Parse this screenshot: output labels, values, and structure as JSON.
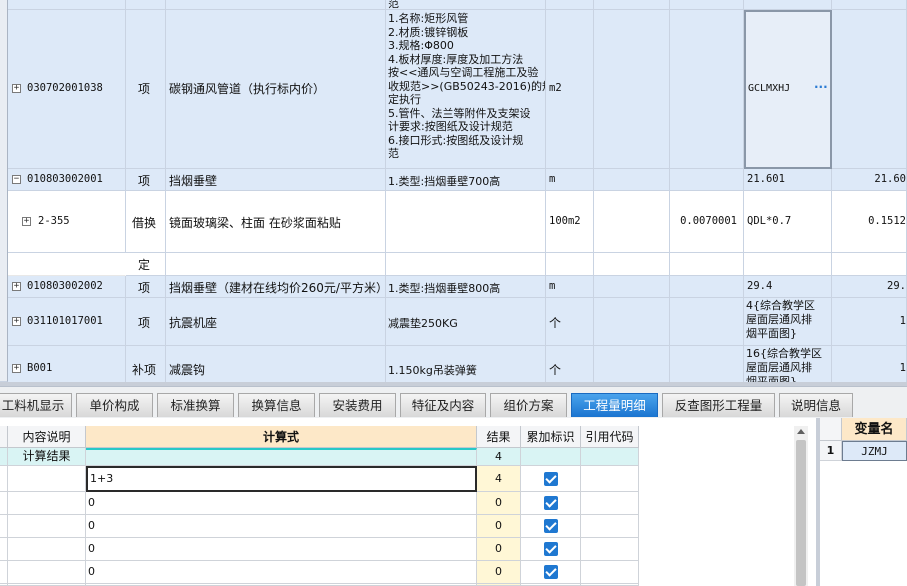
{
  "rows": [
    {
      "code": "",
      "type": "",
      "name": "",
      "desc": "范",
      "unit": "",
      "qty": "",
      "formula": "",
      "total": ""
    },
    {
      "code": "030702001038",
      "type": "项",
      "name": "碳钢通风管道（执行标内价）",
      "desc": "1.名称:矩形风管\n2.材质:镀锌钢板\n3.规格:Φ800\n4.板材厚度:厚度及加工方法\n按<<通风与空调工程施工及验\n收规范>>(GB50243-2016)的规\n定执行\n5.管件、法兰等附件及支架设\n计要求:按图纸及设计规范\n6.接口形式:按图纸及设计规\n范",
      "unit": "m2",
      "qty": "",
      "formula": "GCLMXHJ",
      "formula_btn": "···",
      "total": ""
    },
    {
      "code": "010803002001",
      "type": "项",
      "name": "挡烟垂壁",
      "desc": "1.类型:挡烟垂壁700高",
      "unit": "m",
      "qty": "",
      "formula": "21.601",
      "total": "21.60"
    },
    {
      "code": "2-355",
      "type": "借换",
      "name": "镜面玻璃梁、柱面 在砂浆面粘贴",
      "desc": "",
      "unit": "100m2",
      "qty": "0.0070001",
      "formula": "QDL*0.7",
      "total": "0.1512"
    },
    {
      "code": "",
      "type": "定",
      "name": "",
      "desc": "",
      "unit": "",
      "qty": "",
      "formula": "",
      "total": ""
    },
    {
      "code": "010803002002",
      "type": "项",
      "name": "挡烟垂壁（建材在线均价260元/平方米）",
      "desc": "1.类型:挡烟垂壁800高",
      "unit": "m",
      "qty": "",
      "formula": "29.4",
      "total": "29."
    },
    {
      "code": "031101017001",
      "type": "项",
      "name": "抗震机座",
      "desc": "减震垫250KG",
      "unit": "个",
      "qty": "",
      "formula": "4{综合教学区\n屋面层通风排\n烟平面图}",
      "total": "1"
    },
    {
      "code": "B001",
      "type": "补项",
      "name": "减震钩",
      "desc": "1.150kg吊装弹簧",
      "unit": "个",
      "qty": "",
      "formula": "16{综合教学区\n屋面层通风排\n烟平面图}",
      "total": "1"
    }
  ],
  "tabs": [
    "工料机显示",
    "单价构成",
    "标准换算",
    "换算信息",
    "安装费用",
    "特征及内容",
    "组价方案",
    "工程量明细",
    "反查图形工程量",
    "说明信息"
  ],
  "active_tab": "工程量明细",
  "detail": {
    "headers": {
      "content": "内容说明",
      "formula": "计算式",
      "result": "结果",
      "accum": "累加标识",
      "ref": "引用代码"
    },
    "summary": {
      "content": "计算结果",
      "result": "4"
    },
    "rows": [
      {
        "formula": "1+3",
        "result": "4"
      },
      {
        "formula": "0",
        "result": "0"
      },
      {
        "formula": "0",
        "result": "0"
      },
      {
        "formula": "0",
        "result": "0"
      },
      {
        "formula": "0",
        "result": "0"
      },
      {
        "formula": "",
        "result": ""
      }
    ]
  },
  "variables": {
    "header": "变量名",
    "rows": [
      {
        "index": "1",
        "name": "JZMJ"
      }
    ]
  }
}
